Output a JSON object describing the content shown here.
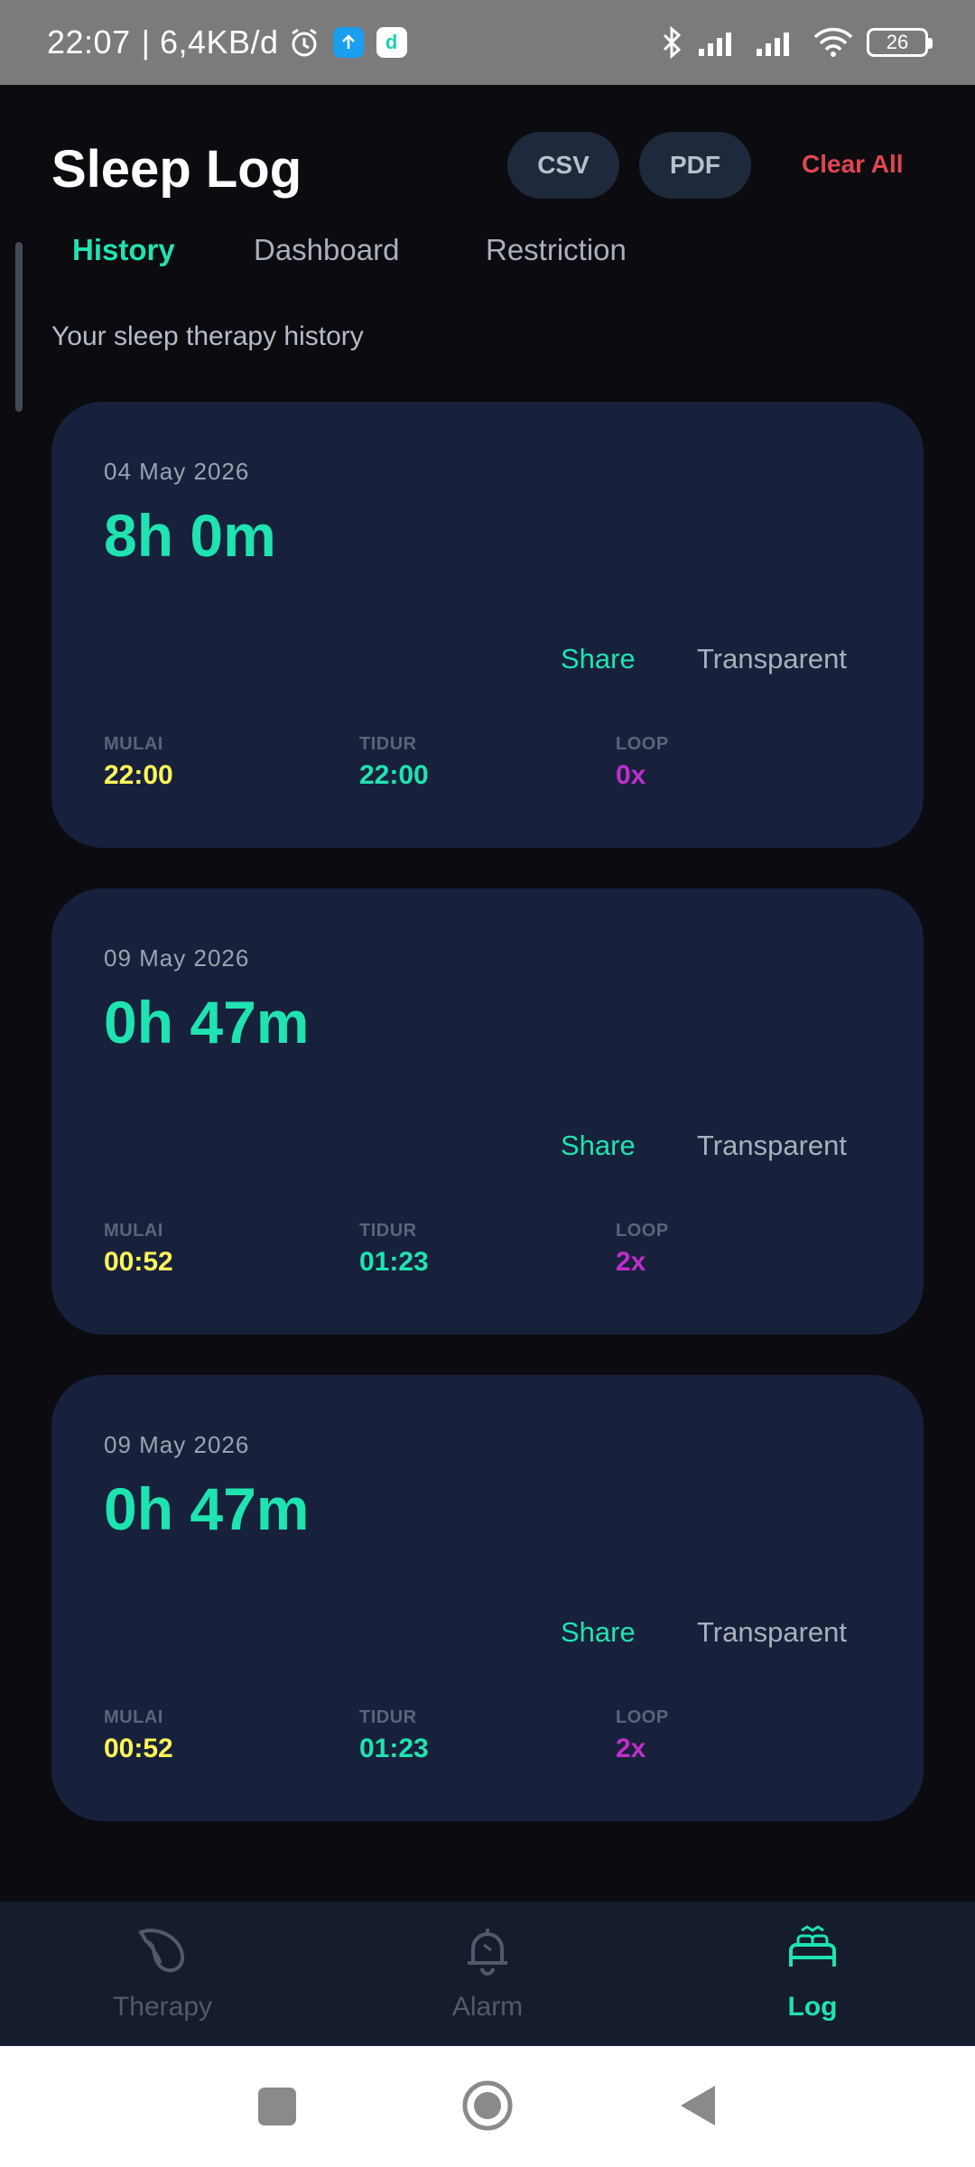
{
  "status_bar": {
    "time": "22:07",
    "speed": "| 6,4KB/d",
    "battery": "26"
  },
  "header": {
    "title": "Sleep Log",
    "csv_label": "CSV",
    "pdf_label": "PDF",
    "clear_all_label": "Clear All"
  },
  "tabs": [
    {
      "label": "History",
      "active": true
    },
    {
      "label": "Dashboard",
      "active": false
    },
    {
      "label": "Restriction",
      "active": false
    }
  ],
  "subtitle": "Your sleep therapy history",
  "cards": [
    {
      "date": "04 May 2026",
      "duration": "8h 0m",
      "share_label": "Share",
      "transparent_label": "Transparent",
      "mulai_label": "MULAI",
      "mulai_value": "22:00",
      "tidur_label": "TIDUR",
      "tidur_value": "22:00",
      "loop_label": "LOOP",
      "loop_value": "0x"
    },
    {
      "date": "09 May 2026",
      "duration": "0h 47m",
      "share_label": "Share",
      "transparent_label": "Transparent",
      "mulai_label": "MULAI",
      "mulai_value": "00:52",
      "tidur_label": "TIDUR",
      "tidur_value": "01:23",
      "loop_label": "LOOP",
      "loop_value": "2x"
    },
    {
      "date": "09 May 2026",
      "duration": "0h 47m",
      "share_label": "Share",
      "transparent_label": "Transparent",
      "mulai_label": "MULAI",
      "mulai_value": "00:52",
      "tidur_label": "TIDUR",
      "tidur_value": "01:23",
      "loop_label": "LOOP",
      "loop_value": "2x"
    }
  ],
  "bottom_nav": [
    {
      "label": "Therapy",
      "icon": "leaf-icon",
      "active": false
    },
    {
      "label": "Alarm",
      "icon": "bell-icon",
      "active": false
    },
    {
      "label": "Log",
      "icon": "bed-icon",
      "active": true
    }
  ],
  "colors": {
    "accent": "#1fe3b0",
    "danger": "#e0474f",
    "card_bg": "#17213c",
    "start_value": "#fff55a",
    "loop_value": "#c12ec9"
  }
}
